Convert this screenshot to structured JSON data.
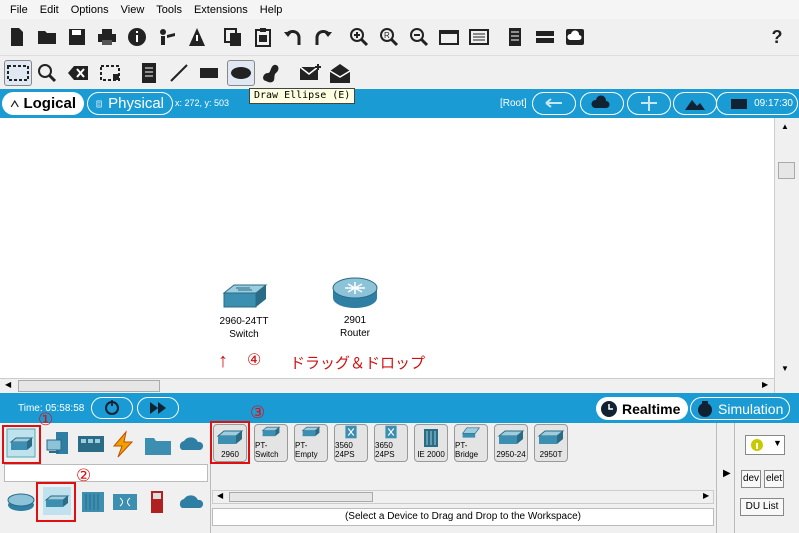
{
  "menu": [
    "File",
    "Edit",
    "Options",
    "View",
    "Tools",
    "Extensions",
    "Help"
  ],
  "toolbar_icons": [
    "new-file-icon",
    "open-folder-icon",
    "save-icon",
    "print-icon",
    "info-icon",
    "activity-wizard-icon",
    "pdu-icon",
    "copy-icon",
    "paste-icon",
    "undo-icon",
    "redo-icon",
    "zoom-in-icon",
    "zoom-reset-icon",
    "zoom-out-icon",
    "drawing-palette-icon",
    "custom-device-icon",
    "notes-icon",
    "network-view-icon",
    "cloud-icon"
  ],
  "help_icon": "?",
  "tooltip": "Draw Ellipse (E)",
  "workbar": {
    "logical": "Logical",
    "physical": "Physical",
    "coords": "x: 272, y: 503",
    "root": "[Root]",
    "time": "09:17:30"
  },
  "devices": [
    {
      "name": "2960-24TT",
      "type": "Switch"
    },
    {
      "name": "2901",
      "type": "Router"
    }
  ],
  "annotations": {
    "n1": "①",
    "n2": "②",
    "n3": "③",
    "n4": "④",
    "drag_drop": "ドラッグ＆ドロップ",
    "arrow": "↑"
  },
  "timebar": {
    "time": "Time: 05:58:58",
    "realtime": "Realtime",
    "simulation": "Simulation"
  },
  "device_list": [
    "2960",
    "PT-Switch",
    "PT-Empty",
    "3560 24PS",
    "3650 24PS",
    "IE 2000",
    "PT-Bridge",
    "2950-24",
    "2950T"
  ],
  "status_hint": "(Select a Device to Drag and Drop to the Workspace)",
  "right_panel": {
    "dev": "dev",
    "del": "elet",
    "pdu": "DU List"
  }
}
